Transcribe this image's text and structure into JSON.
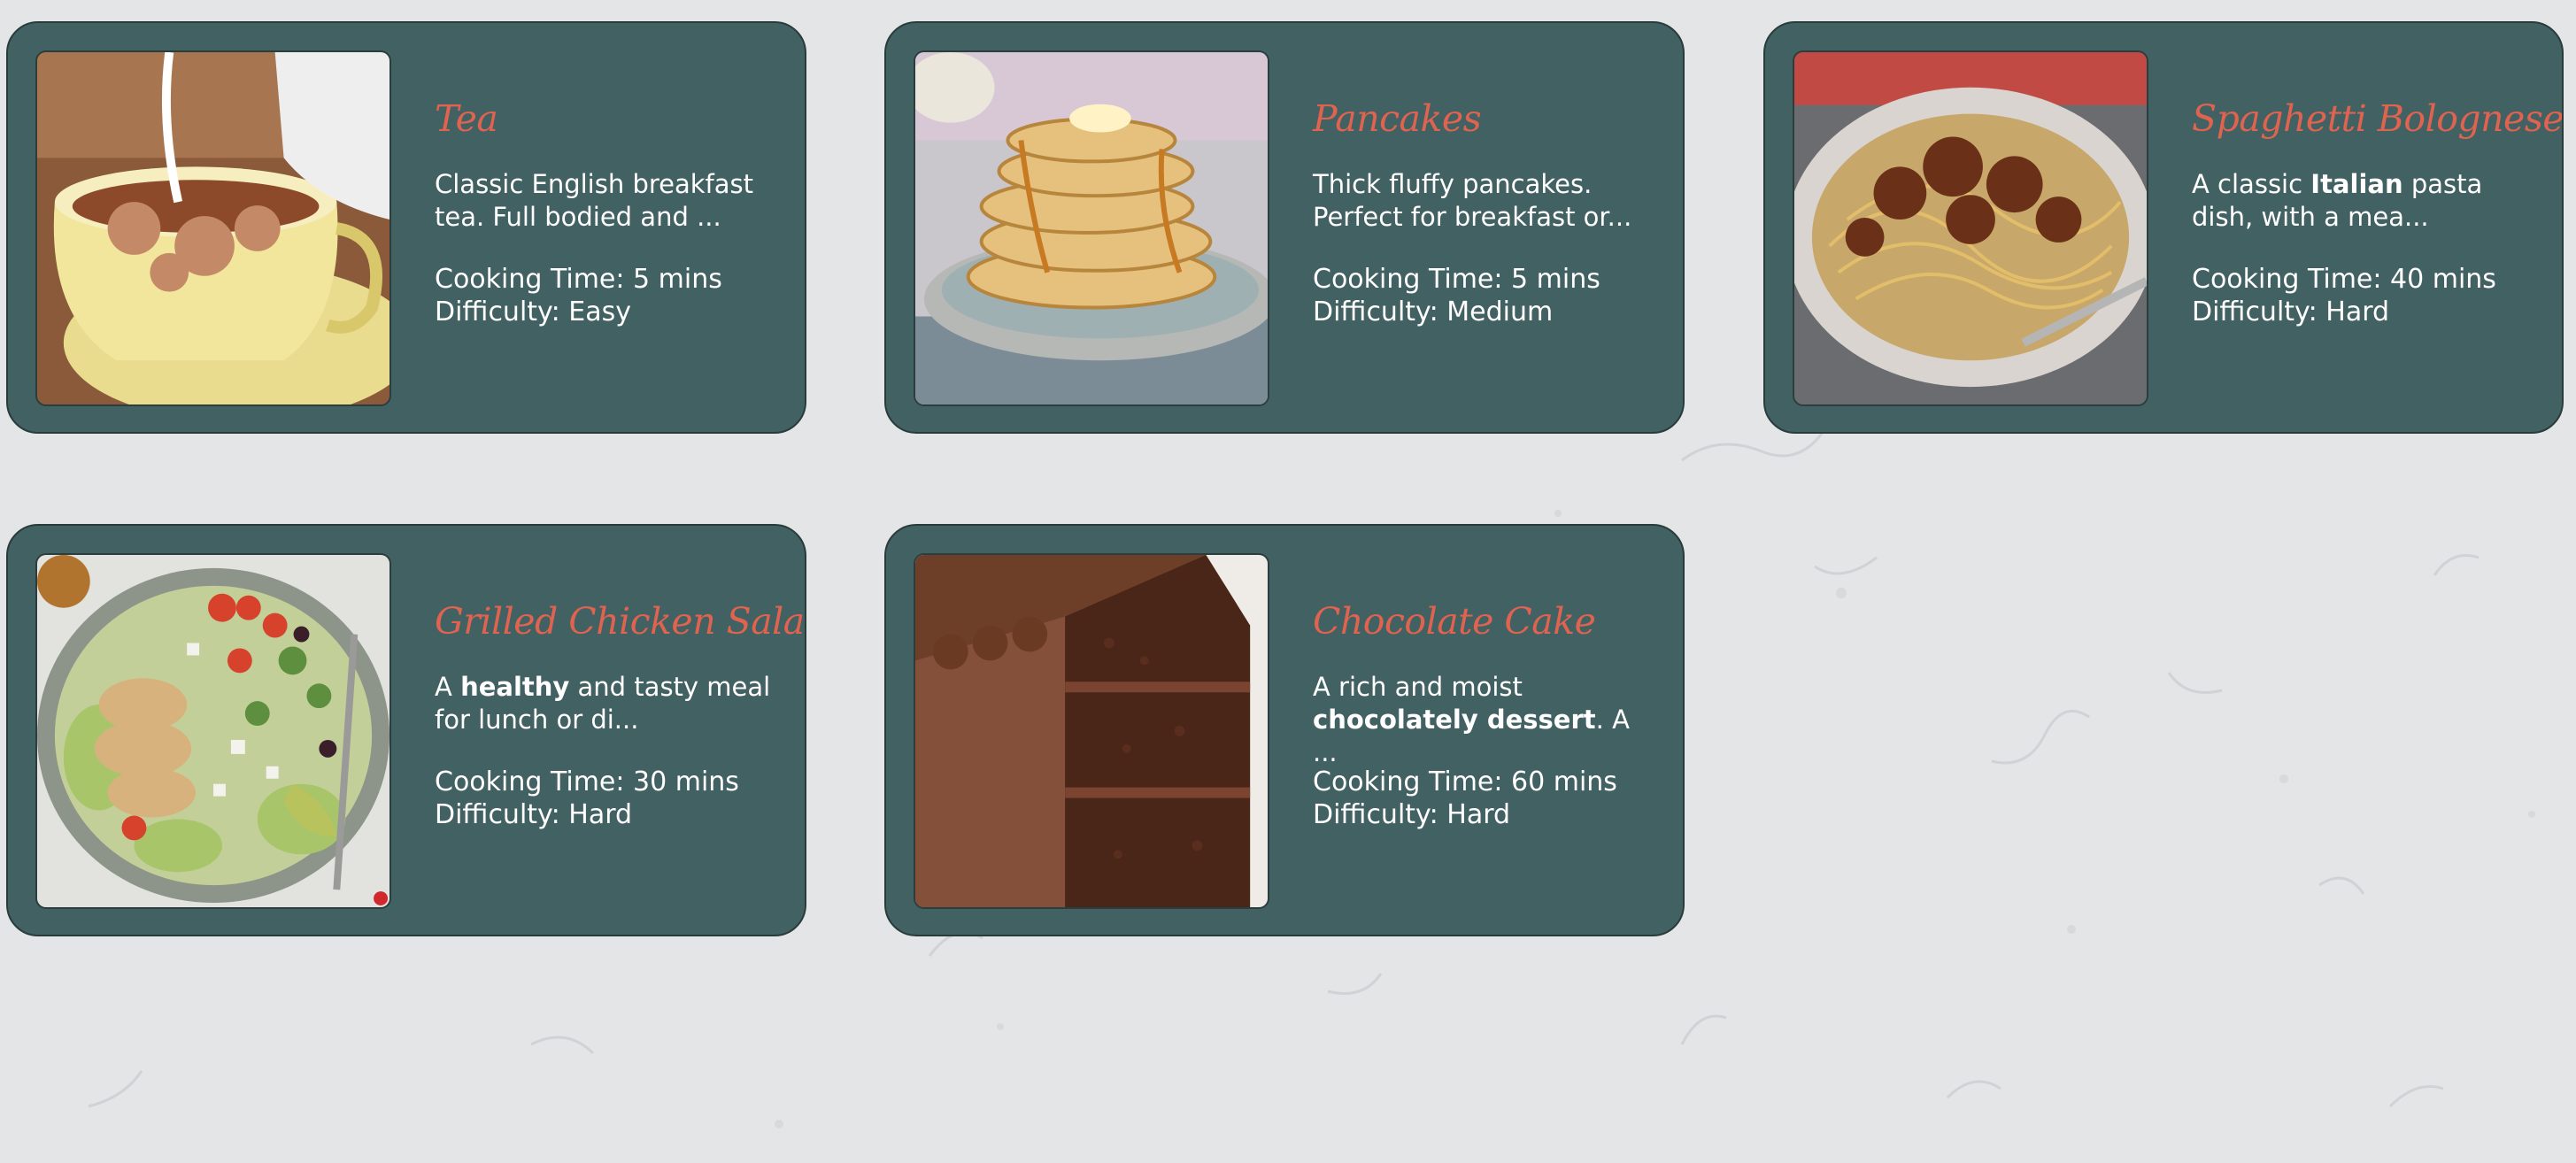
{
  "recipes": [
    {
      "title": "Tea",
      "desc": [
        {
          "t": "Classic English breakfast tea. Full bodied and ...",
          "b": false
        }
      ],
      "time_label": "Cooking Time: 5 mins",
      "difficulty_label": "Difficulty: Easy"
    },
    {
      "title": "Pancakes",
      "desc": [
        {
          "t": "Thick fluffy pancakes. Perfect for breakfast or...",
          "b": false
        }
      ],
      "time_label": "Cooking Time: 5 mins",
      "difficulty_label": "Difficulty: Medium"
    },
    {
      "title": "Spaghetti Bolognese",
      "desc": [
        {
          "t": "A classic ",
          "b": false
        },
        {
          "t": "Italian",
          "b": true
        },
        {
          "t": " pasta dish, with a mea...",
          "b": false
        }
      ],
      "time_label": "Cooking Time: 40 mins",
      "difficulty_label": "Difficulty: Hard"
    },
    {
      "title": "Grilled Chicken Salad",
      "desc": [
        {
          "t": "A ",
          "b": false
        },
        {
          "t": "healthy",
          "b": true
        },
        {
          "t": " and tasty meal for lunch or di...",
          "b": false
        }
      ],
      "time_label": "Cooking Time: 30 mins",
      "difficulty_label": "Difficulty: Hard"
    },
    {
      "title": "Chocolate Cake",
      "desc": [
        {
          "t": "A rich and moist ",
          "b": false
        },
        {
          "t": "chocolately dessert",
          "b": true
        },
        {
          "t": ". A ...",
          "b": false
        }
      ],
      "time_label": "Cooking Time: 60 mins",
      "difficulty_label": "Difficulty: Hard"
    }
  ],
  "colors": {
    "card_bg": "#426163",
    "title": "#e0634f",
    "text": "#ffffff",
    "page_bg": "#e4e5e7"
  }
}
